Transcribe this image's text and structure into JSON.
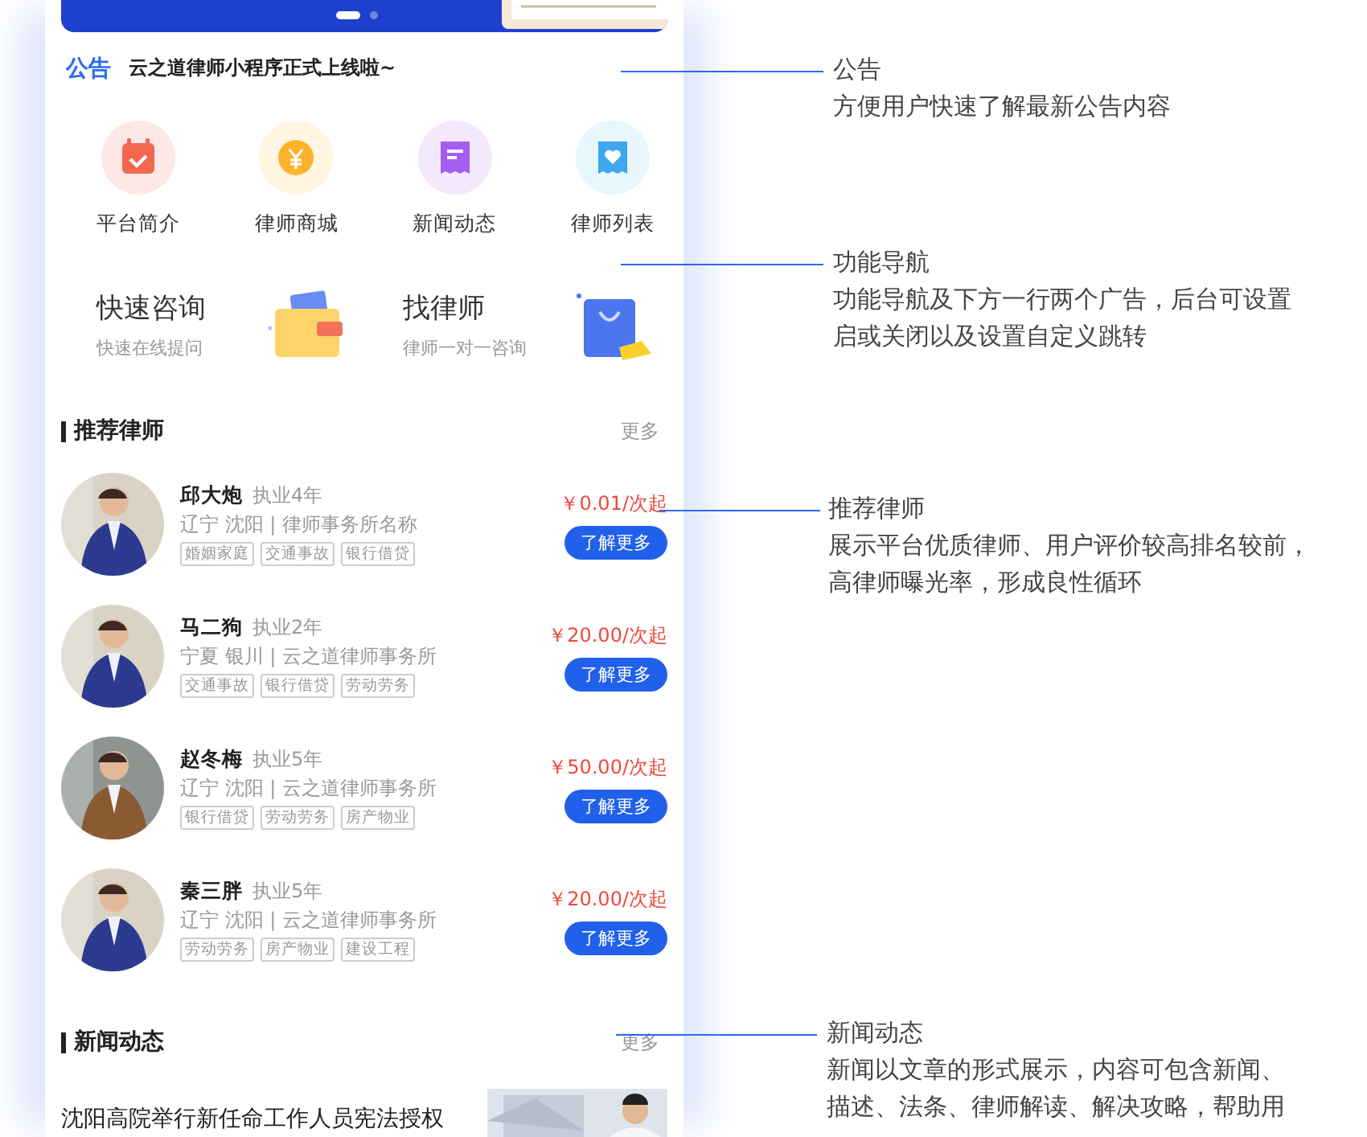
{
  "banner": {
    "dots": [
      {
        "selected": true
      },
      {
        "selected": false
      }
    ]
  },
  "notice": {
    "label": "公告",
    "text": "云之道律师小程序正式上线啦~"
  },
  "nav": [
    {
      "label": "平台简介",
      "kind": "calendar"
    },
    {
      "label": "律师商城",
      "kind": "coin"
    },
    {
      "label": "新闻动态",
      "kind": "document"
    },
    {
      "label": "律师列表",
      "kind": "heart"
    }
  ],
  "promos": [
    {
      "title": "快速咨询",
      "subtitle": "快速在线提问",
      "kind": "wallet"
    },
    {
      "title": "找律师",
      "subtitle": "律师一对一咨询",
      "kind": "bag"
    }
  ],
  "lawyer_section": {
    "title": "推荐律师",
    "more": "更多"
  },
  "lawyers": [
    {
      "name": "邱大炮",
      "years": "执业4年",
      "location": "辽宁 沈阳 | 律师事务所名称",
      "tags": [
        "婚姻家庭",
        "交通事故",
        "银行借贷"
      ],
      "price": "￥0.01/次起",
      "button": "了解更多",
      "kind": "suit"
    },
    {
      "name": "马二狗",
      "years": "执业2年",
      "location": "宁夏 银川 | 云之道律师事务所",
      "tags": [
        "交通事故",
        "银行借贷",
        "劳动劳务"
      ],
      "price": "￥20.00/次起",
      "button": "了解更多",
      "kind": "suit"
    },
    {
      "name": "赵冬梅",
      "years": "执业5年",
      "location": "辽宁 沈阳 | 云之道律师事务所",
      "tags": [
        "银行借贷",
        "劳动劳务",
        "房产物业"
      ],
      "price": "￥50.00/次起",
      "button": "了解更多",
      "kind": "coat"
    },
    {
      "name": "秦三胖",
      "years": "执业5年",
      "location": "辽宁 沈阳 | 云之道律师事务所",
      "tags": [
        "劳动劳务",
        "房产物业",
        "建设工程"
      ],
      "price": "￥20.00/次起",
      "button": "了解更多",
      "kind": "suit"
    }
  ],
  "news_section": {
    "title": "新闻动态",
    "more": "更多"
  },
  "news": [
    {
      "title": "沈阳高院举行新任命工作人员宪法授权"
    }
  ],
  "annotations": [
    {
      "title": "公告",
      "lines": [
        "方便用户快速了解最新公告内容"
      ]
    },
    {
      "title": "功能导航",
      "lines": [
        "功能导航及下方一行两个广告，后台可设置",
        "启或关闭以及设置自定义跳转"
      ]
    },
    {
      "title": "推荐律师",
      "lines": [
        "展示平台优质律师、用户评价较高排名较前，",
        "高律师曝光率，形成良性循环"
      ]
    },
    {
      "title": "新闻动态",
      "lines": [
        "新闻以文章的形式展示，内容可包含新闻、",
        "描述、法条、律师解读、解决攻略，帮助用"
      ]
    }
  ]
}
